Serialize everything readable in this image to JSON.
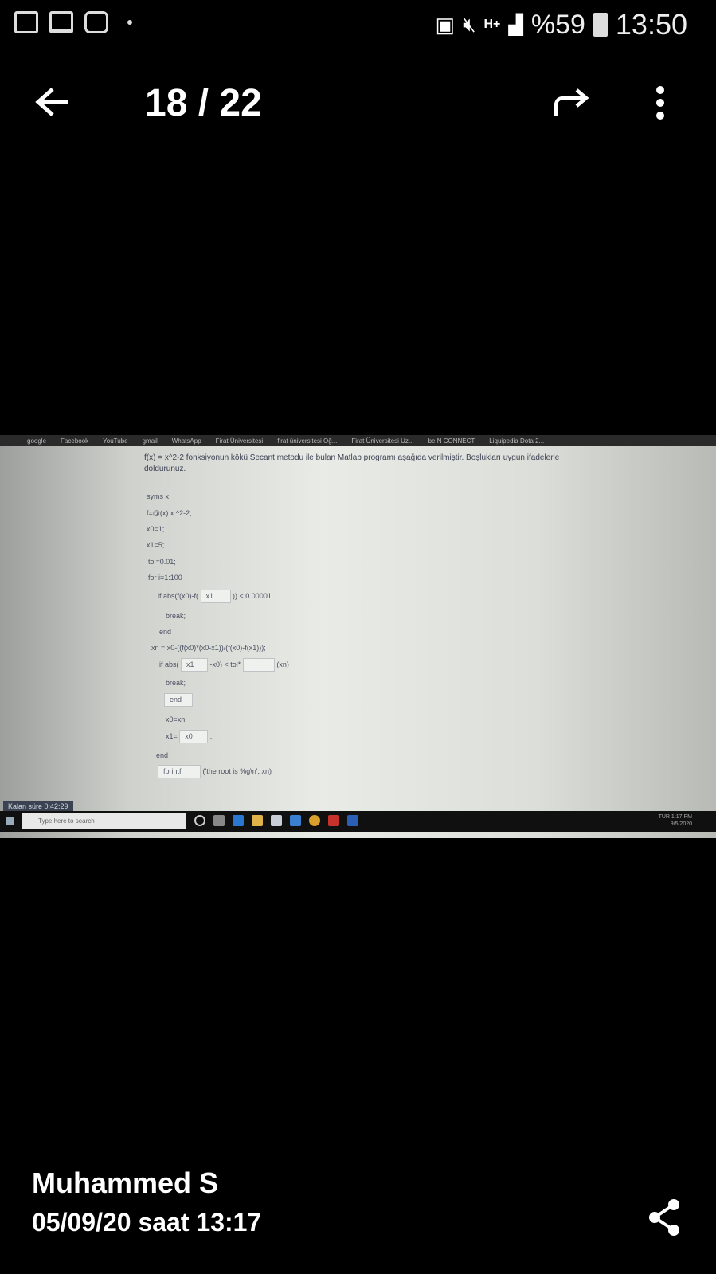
{
  "status_bar": {
    "battery": "%59",
    "time": "13:50",
    "network": "H+"
  },
  "header": {
    "counter": "18 / 22"
  },
  "photo": {
    "bookmarks": [
      "google",
      "Facebook",
      "YouTube",
      "gmail",
      "WhatsApp",
      "Firat Üniversitesi",
      "firat üniversitesi Oğ...",
      "Firat Üniversitesi Uz...",
      "beIN CONNECT",
      "Liquipedia Dota 2..."
    ],
    "question": "f(x) = x^2-2 fonksiyonun kökü Secant metodu ile bulan Matlab programı aşağıda verilmiştir. Boşlukları uygun ifadelerle doldurunuz.",
    "code": {
      "l1": "syms x",
      "l2": "f=@(x) x.^2-2;",
      "l3": "x0=1;",
      "l4": "x1=5;",
      "l5": "tol=0.01;",
      "l6": "for i=1:100",
      "l7a": "if abs(f(x0)-f(",
      "l7b": "x1",
      "l7c": ")) < 0.00001",
      "l8": "break;",
      "l9": "end",
      "l10": "xn = x0-((f(x0)*(x0-x1))/(f(x0)-f(x1)));",
      "l11a": "if abs(",
      "l11b": "x1",
      "l11c": "-x0) < tol*",
      "l11d": "",
      "l11e": "(xn)",
      "l12": "break;",
      "l13": "end",
      "l14": "x0=xn;",
      "l15a": "x1=",
      "l15b": "x0",
      "l15c": ";",
      "l16": "end",
      "l17a": "fprintf",
      "l17b": "('the root is %g\\n', xn)"
    },
    "timer": "Kalan süre 0:42:29",
    "search_placeholder": "Type here to search",
    "tray_lang": "TUR",
    "tray_time": "1:17 PM",
    "tray_date": "9/5/2020"
  },
  "footer": {
    "author": "Muhammed S",
    "date": "05/09/20 saat 13:17"
  }
}
